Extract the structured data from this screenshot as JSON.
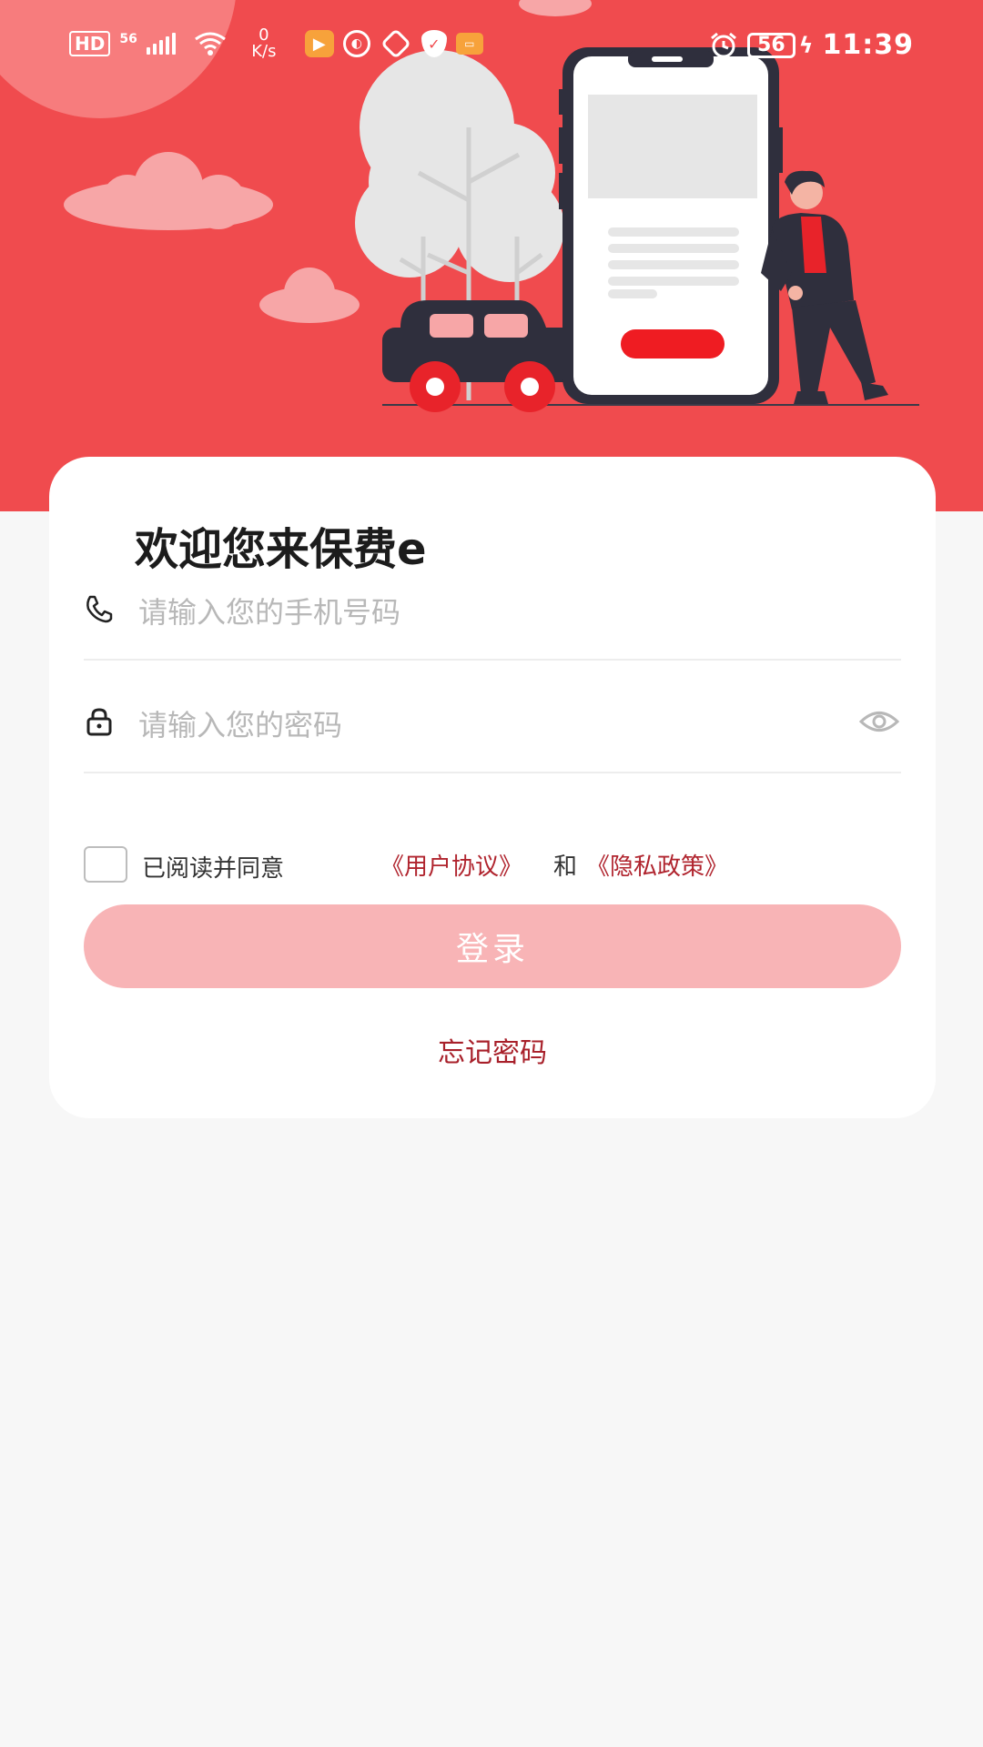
{
  "status_bar": {
    "hd": "HD",
    "signal_label": "56",
    "speed_value": "0",
    "speed_unit": "K/s",
    "battery": "56",
    "time": "11:39",
    "app_icons": [
      "video-app-icon",
      "browser-app-icon",
      "stop-app-icon",
      "shield-app-icon",
      "wallet-app-icon"
    ]
  },
  "login": {
    "welcome_title": "欢迎您来保费e",
    "phone_placeholder": "请输入您的手机号码",
    "password_placeholder": "请输入您的密码",
    "agree_text": "已阅读并同意",
    "user_agreement": "《用户协议》",
    "and_text": "和",
    "privacy_policy": "《隐私政策》",
    "login_button": "登录",
    "forgot_password": "忘记密码"
  },
  "colors": {
    "banner": "#f04b4e",
    "login_button": "#f8b4b6",
    "link": "#b0242e"
  }
}
